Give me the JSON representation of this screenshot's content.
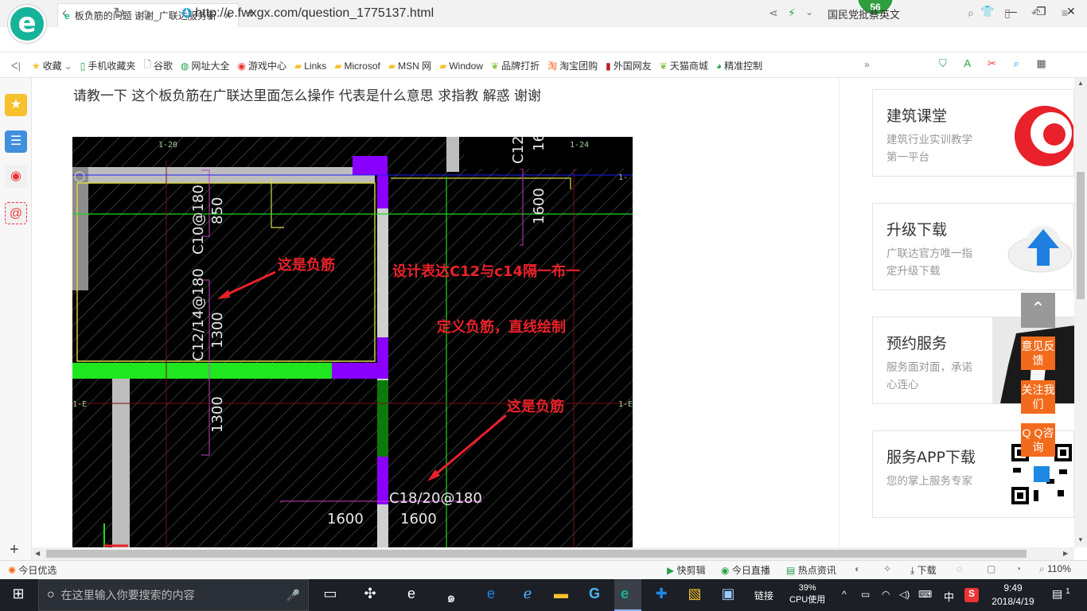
{
  "browser": {
    "tab_title": "板负筋的问题 谢谢_广联达服务新",
    "url": "http://e.fwxgx.com/question_1775137.html",
    "url_highlight": "fwxgx",
    "search_text": "国民党批蔡英文",
    "badge_count": "56"
  },
  "bookmarks": [
    {
      "label": "收藏",
      "icon": "star-icon"
    },
    {
      "label": "手机收藏夹",
      "icon": "phone-icon"
    },
    {
      "label": "谷歌",
      "icon": "page-icon"
    },
    {
      "label": "网址大全",
      "icon": "globe-icon"
    },
    {
      "label": "游戏中心",
      "icon": "game-icon"
    },
    {
      "label": "Links",
      "icon": "folder-icon"
    },
    {
      "label": "Microsof",
      "icon": "folder-icon"
    },
    {
      "label": "MSN 网",
      "icon": "folder-icon"
    },
    {
      "label": "Window",
      "icon": "folder-icon"
    },
    {
      "label": "品牌打折",
      "icon": "leaf-icon"
    },
    {
      "label": "淘宝团购",
      "icon": "taobao-icon"
    },
    {
      "label": "外国网友",
      "icon": "bookmark-icon"
    },
    {
      "label": "天猫商城",
      "icon": "leaf-icon"
    },
    {
      "label": "精准控制",
      "icon": "wechat-icon"
    }
  ],
  "question_text": "请教一下  这个板负筋在广联达里面怎么操作   代表是什么意思  求指教  解惑  谢谢",
  "cad": {
    "axis_1_20": "1-20",
    "axis_1_24": "1-24",
    "axis_1_e_left": "1-E",
    "axis_1_e_right": "1-E",
    "axis_1_right_top": "1-",
    "label_c12_top": "C12",
    "label_16": "16",
    "label_1600_vert": "1600",
    "label_c10": "C10@180",
    "label_850": "850",
    "label_c12_14": "C12/14@180",
    "label_1300a": "1300",
    "label_1300b": "1300",
    "label_c18_20": "C18/20@180",
    "label_1600a": "1600",
    "label_1600b": "1600",
    "note_neg_1": "这是负筋",
    "note_design": "设计表达C12与c14隔一布一",
    "note_define": "定义负筋，直线绘制",
    "note_neg_2": "这是负筋"
  },
  "right_cards": [
    {
      "title": "建筑课堂",
      "desc": "建筑行业实训教学第一平台"
    },
    {
      "title": "升级下载",
      "desc": "广联达官方唯一指定升级下载"
    },
    {
      "title": "预约服务",
      "desc": "服务面对面，承诺心连心"
    },
    {
      "title": "服务APP下载",
      "desc": "您的掌上服务专家"
    }
  ],
  "float_buttons": {
    "feedback": "意见反馈",
    "follow": "关注我们",
    "qq": "Q Q咨询"
  },
  "statusbar": {
    "today_pick": "今日优选",
    "quick_cut": "快剪辑",
    "live": "今日直播",
    "news": "热点资讯",
    "download": "下载",
    "zoom": "110%"
  },
  "taskbar": {
    "search_placeholder": "在这里输入你要搜索的内容",
    "links": "链接",
    "cpu_percent": "39%",
    "cpu_label": "CPU使用",
    "ime": "中",
    "time": "9:49",
    "date": "2018/4/19",
    "notif_count": "1"
  },
  "colors": {
    "accent_green": "#16b39a",
    "cad_background": "#000000",
    "annotation_red": "#e8212a",
    "float_orange": "#f26b1c"
  }
}
